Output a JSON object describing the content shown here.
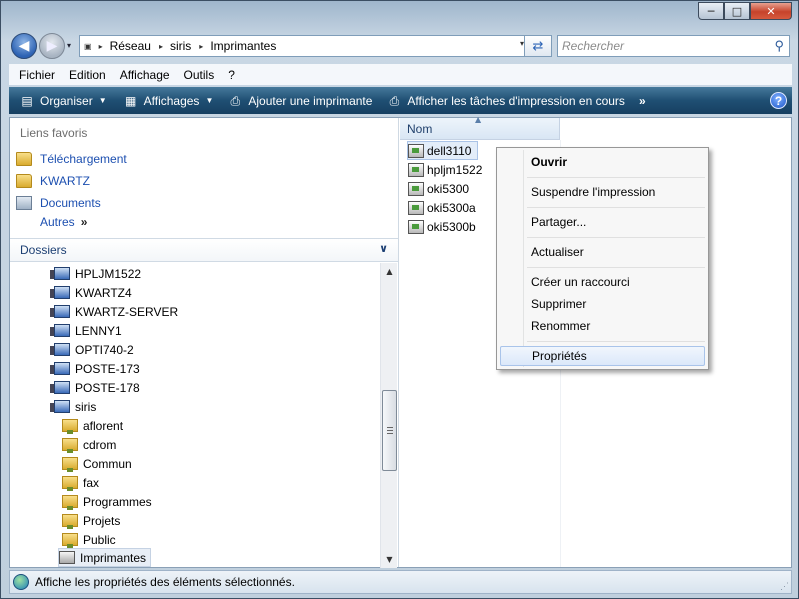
{
  "window": {
    "min_glyph": "─",
    "max_glyph": "□",
    "close_glyph": "✕"
  },
  "address": {
    "crumbs": [
      "Réseau",
      "siris",
      "Imprimantes"
    ],
    "separator": "▸",
    "dropdown": "▾",
    "refresh_glyph": "⇄",
    "search_placeholder": "Rechercher",
    "search_glyph": "⚲"
  },
  "menu": [
    "Fichier",
    "Edition",
    "Affichage",
    "Outils",
    "?"
  ],
  "toolbar": {
    "items": [
      {
        "label": "Organiser",
        "icon": "organize-icon",
        "glyph": "▤",
        "dropdown": true
      },
      {
        "label": "Affichages",
        "icon": "views-icon",
        "glyph": "▦",
        "dropdown": true
      },
      {
        "label": "Ajouter une imprimante",
        "icon": "add-printer-icon",
        "glyph": "⎙",
        "dropdown": false
      },
      {
        "label": "Afficher les tâches d'impression en cours",
        "icon": "print-queue-icon",
        "glyph": "⎙",
        "dropdown": false
      }
    ],
    "more": "»",
    "help": "?",
    "caret": "▼"
  },
  "nav": {
    "favorites_title": "Liens favoris",
    "favorites": [
      {
        "label": "Téléchargement",
        "icon": "folder-icon"
      },
      {
        "label": "KWARTZ",
        "icon": "folder-icon"
      },
      {
        "label": "Documents",
        "icon": "documents-icon"
      }
    ],
    "others": "Autres",
    "others_glyph": "»",
    "folders_title": "Dossiers",
    "folders_chevron": "∨",
    "tree": [
      {
        "label": "HPLJM1522",
        "type": "computer",
        "level": 0
      },
      {
        "label": "KWARTZ4",
        "type": "computer",
        "level": 0
      },
      {
        "label": "KWARTZ-SERVER",
        "type": "computer",
        "level": 0
      },
      {
        "label": "LENNY1",
        "type": "computer",
        "level": 0
      },
      {
        "label": "OPTI740-2",
        "type": "computer",
        "level": 0
      },
      {
        "label": "POSTE-173",
        "type": "computer",
        "level": 0
      },
      {
        "label": "POSTE-178",
        "type": "computer",
        "level": 0
      },
      {
        "label": "siris",
        "type": "computer",
        "level": 0
      },
      {
        "label": "aflorent",
        "type": "share",
        "level": 1
      },
      {
        "label": "cdrom",
        "type": "share",
        "level": 1
      },
      {
        "label": "Commun",
        "type": "share",
        "level": 1
      },
      {
        "label": "fax",
        "type": "share",
        "level": 1
      },
      {
        "label": "Programmes",
        "type": "share",
        "level": 1
      },
      {
        "label": "Projets",
        "type": "share",
        "level": 1
      },
      {
        "label": "Public",
        "type": "share",
        "level": 1
      },
      {
        "label": "Imprimantes",
        "type": "printers",
        "level": 1,
        "selected": true
      }
    ],
    "scroll_up": "▲",
    "scroll_down": "▼"
  },
  "files": {
    "column": "Nom",
    "sort_glyph": "▲",
    "items": [
      {
        "label": "dell3110",
        "selected": true
      },
      {
        "label": "hpljm1522",
        "selected": false
      },
      {
        "label": "oki5300",
        "selected": false
      },
      {
        "label": "oki5300a",
        "selected": false
      },
      {
        "label": "oki5300b",
        "selected": false
      }
    ]
  },
  "context_menu": {
    "items": [
      {
        "label": "Ouvrir",
        "bold": true
      },
      {
        "label": "Suspendre l'impression"
      },
      {
        "label": "Partager..."
      },
      {
        "label": "Actualiser"
      },
      {
        "label": "Créer un raccourci"
      },
      {
        "label": "Supprimer"
      },
      {
        "label": "Renommer"
      },
      {
        "label": "Propriétés",
        "highlighted": true
      }
    ]
  },
  "status": {
    "text": "Affiche les propriétés des éléments sélectionnés.",
    "grip": "⋰"
  }
}
